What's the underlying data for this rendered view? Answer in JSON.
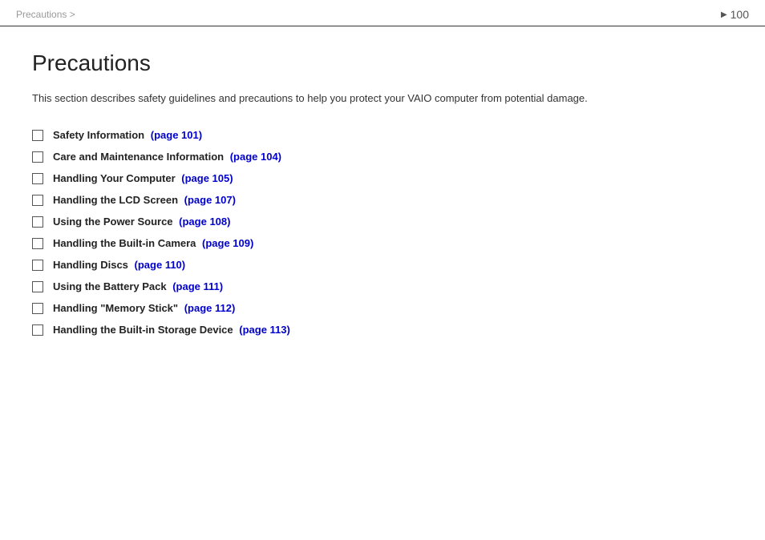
{
  "header": {
    "breadcrumb": "Precautions >",
    "page_number": "100"
  },
  "main": {
    "title": "Precautions",
    "intro": "This section describes safety guidelines and precautions to help you protect your VAIO computer from potential damage.",
    "toc_items": [
      {
        "label": "Safety Information",
        "link_text": "(page 101)",
        "page": "101"
      },
      {
        "label": "Care and Maintenance Information",
        "link_text": "(page 104)",
        "page": "104"
      },
      {
        "label": "Handling Your Computer",
        "link_text": "(page 105)",
        "page": "105"
      },
      {
        "label": "Handling the LCD Screen",
        "link_text": "(page 107)",
        "page": "107"
      },
      {
        "label": "Using the Power Source",
        "link_text": "(page 108)",
        "page": "108"
      },
      {
        "label": "Handling the Built-in Camera",
        "link_text": "(page 109)",
        "page": "109"
      },
      {
        "label": "Handling Discs",
        "link_text": "(page 110)",
        "page": "110"
      },
      {
        "label": "Using the Battery Pack",
        "link_text": "(page 111)",
        "page": "111"
      },
      {
        "label": "Handling \"Memory Stick\"",
        "link_text": "(page 112)",
        "page": "112"
      },
      {
        "label": "Handling the Built-in Storage Device",
        "link_text": "(page 113)",
        "page": "113"
      }
    ]
  }
}
